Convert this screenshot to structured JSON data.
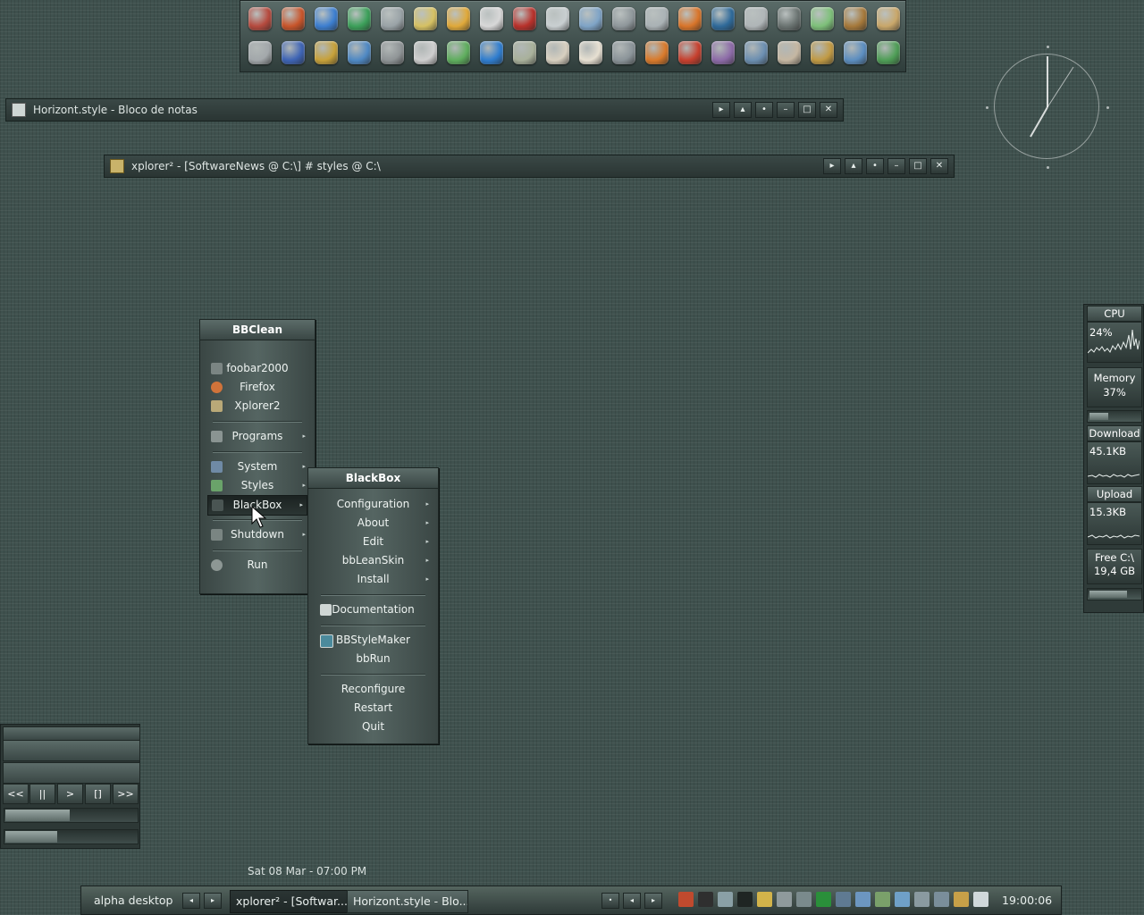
{
  "dock": {
    "row1": [
      "#b64a3e",
      "#c8552b",
      "#3d7fd0",
      "#3ca05a",
      "#9aa3a7",
      "#d6c163",
      "#e0a93a",
      "#d8d8d8",
      "#b8312b",
      "#c9cfd1",
      "#7fa4c7",
      "#8f979b",
      "#aab2b5",
      "#d9752a",
      "#2f6a9a",
      "#b0b6b8",
      "#6b7472",
      "#7ec07a",
      "#a6793b",
      "#c9a76a"
    ],
    "row2": [
      "#a3a8ab",
      "#3e64b5",
      "#c7a13a",
      "#4f89c4",
      "#8f9496",
      "#cfcfcf",
      "#5fae5e",
      "#2f7dcf",
      "#a9b19b",
      "#d8d0c0",
      "#e7e0d2",
      "#8b9499",
      "#d97a2b",
      "#c7402e",
      "#8d6ba8",
      "#6c8fb1",
      "#c5b7a2",
      "#c19a44",
      "#5c8ec0",
      "#4f9e57"
    ]
  },
  "windows": {
    "notepad_title": "Horizont.style - Bloco de notas",
    "xplorer_title": "xplorer² - [SoftwareNews @ C:\\] # styles @ C:\\"
  },
  "title_buttons": {
    "next": "▸",
    "up": "▴",
    "dot": "•",
    "minimize": "–",
    "maximize": "□",
    "close": "✕"
  },
  "menu_main": {
    "title": "BBClean",
    "items": {
      "foobar": "foobar2000",
      "firefox": "Firefox",
      "xplorer": "Xplorer2",
      "programs": "Programs",
      "system": "System",
      "styles": "Styles",
      "blackbox": "BlackBox",
      "shutdown": "Shutdown",
      "run": "Run"
    }
  },
  "menu_sub": {
    "title": "BlackBox",
    "items": {
      "configuration": "Configuration",
      "about": "About",
      "edit": "Edit",
      "bbleanskin": "bbLeanSkin",
      "install": "Install",
      "documentation": "Documentation",
      "bbstylemaker": "BBStyleMaker",
      "bbrun": "bbRun",
      "reconfigure": "Reconfigure",
      "restart": "Restart",
      "quit": "Quit"
    }
  },
  "submenu_arrow": "▸",
  "monitor": {
    "cpu_label": "CPU",
    "cpu_value": "24%",
    "memory_label": "Memory",
    "memory_value": "37%",
    "memory_fill": 0.37,
    "download_label": "Download",
    "download_value": "45.1KB",
    "upload_label": "Upload",
    "upload_value": "15.3KB",
    "free_label": "Free C:\\",
    "free_value": "19,4 GB",
    "free_fill": 0.75
  },
  "player": {
    "prev": "<<",
    "pause": "||",
    "play": ">",
    "stop": "[]",
    "next": ">>",
    "seek_fill": 0.49,
    "volume_fill": 0.4
  },
  "datetime": "Sat 08 Mar - 07:00 PM",
  "taskbar": {
    "workspace": "alpha desktop",
    "task1": "xplorer² - [Softwar...",
    "task2": "Horizont.style - Blo...",
    "clock": "19:00:06",
    "btn_left": "◂",
    "btn_right": "▸",
    "btn_dot": "•"
  },
  "tray_colors": [
    "#c04a2e",
    "#2f2f2f",
    "#8aa0a6",
    "#1f2523",
    "#d2b34a",
    "#8f9a9c",
    "#7a8a8c",
    "#2a8f3a",
    "#5f7a92",
    "#6c96c0",
    "#7aa06a",
    "#6fa0c8",
    "#8a9aa0",
    "#7a8e9a",
    "#c7a048",
    "#d0d8da"
  ]
}
